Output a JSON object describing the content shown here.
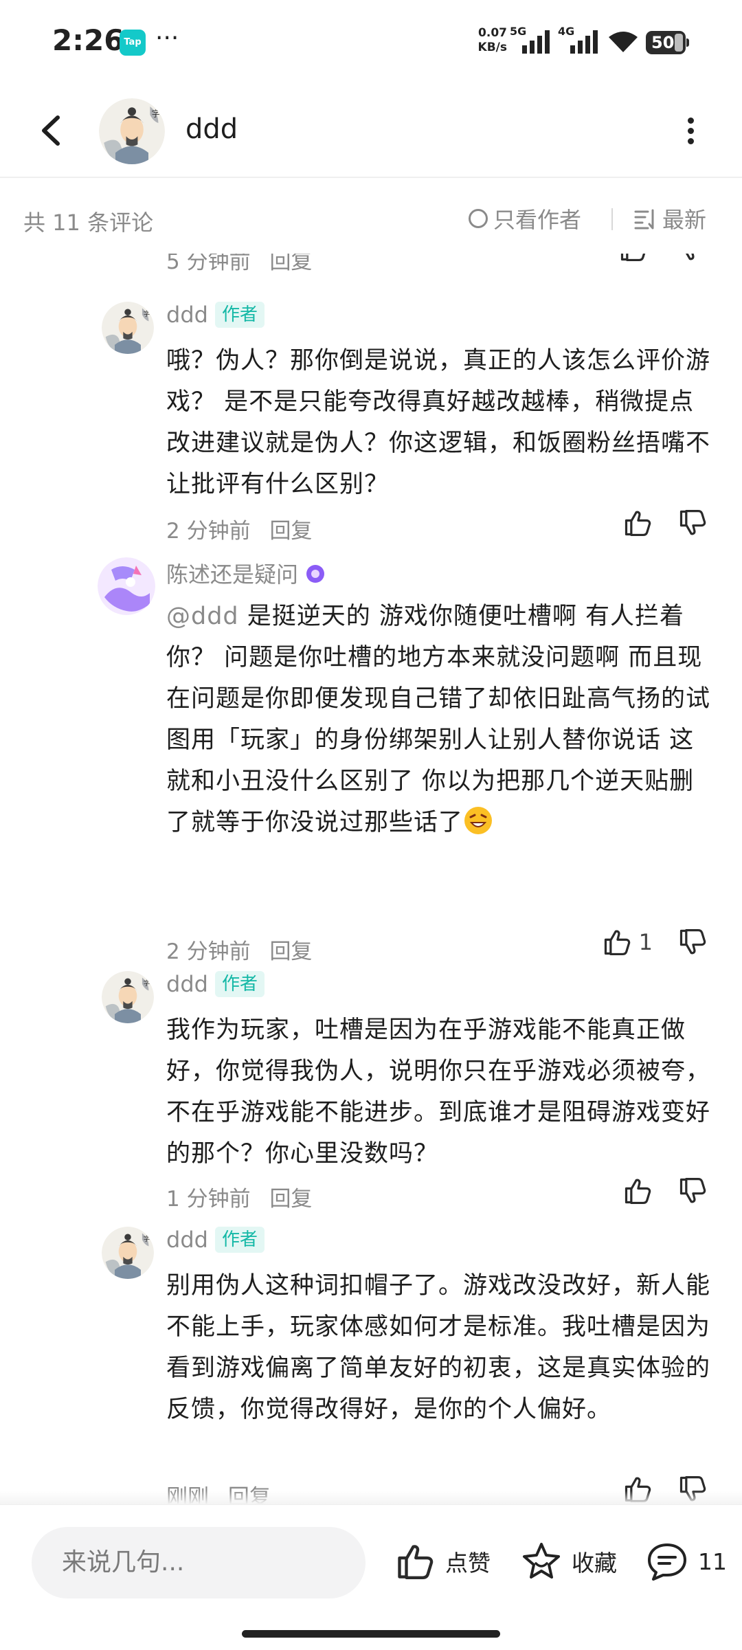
{
  "status_bar": {
    "time": "2:26",
    "app_badge": "Tap",
    "more": "···",
    "speed_value": "0.07",
    "speed_unit": "KB/s",
    "net1": "5G",
    "net2": "4G",
    "battery": "50"
  },
  "header": {
    "title": "ddd"
  },
  "filter": {
    "count_label": "共 11 条评论",
    "only_author_label": "只看作者",
    "sort_label": "最新"
  },
  "comments": [
    {
      "name": "ddd",
      "badge": "作者",
      "text": "哦？伪人？那你倒是说说，真正的人该怎么评价游戏？ 是不是只能夸改得真好越改越棒，稍微提点改进建议就是伪人？你这逻辑，和饭圈粉丝捂嘴不让批评有什么区别？",
      "time": "2 分钟前",
      "reply": "回复"
    },
    {
      "name": "陈述还是疑问",
      "mention": "@ddd",
      "text": "  是挺逆天的  游戏你随便吐槽啊  有人拦着你？    问题是你吐槽的地方本来就没问题啊  而且现在问题是你即便发现自己错了却依旧趾高气扬的试图用「玩家」的身份绑架别人让别人替你说话   这就和小丑没什么区别了   你以为把那几个逆天贴删了就等于你没说过那些话了",
      "time": "2 分钟前",
      "reply": "回复",
      "likes": "1"
    },
    {
      "name": "ddd",
      "badge": "作者",
      "text": "我作为玩家，吐槽是因为在乎游戏能不能真正做好，你觉得我伪人，说明你只在乎游戏必须被夸，不在乎游戏能不能进步。到底谁才是阻碍游戏变好的那个？你心里没数吗？",
      "time": "1 分钟前",
      "reply": "回复"
    },
    {
      "name": "ddd",
      "badge": "作者",
      "text": "别用伪人这种词扣帽子了。游戏改没改好，新人能不能上手，玩家体感如何才是标准。我吐槽是因为看到游戏偏离了简单友好的初衷，这是真实体验的反馈，你觉得改得好，是你的个人偏好。",
      "time": "刚刚",
      "reply": "回复"
    }
  ],
  "partial_top": {
    "time": "5 分钟前",
    "reply": "回复"
  },
  "bottom": {
    "input_placeholder": "来说几句...",
    "like_label": "点赞",
    "fav_label": "收藏",
    "comment_count": "11"
  },
  "colors": {
    "accent": "#14b8a6",
    "badge_bg": "#e3f7f4",
    "muted_text": "#8a8a8a",
    "input_bg": "#f3f3f4"
  },
  "icons": [
    "back-icon",
    "more-vertical-icon",
    "thumb-up-icon",
    "thumb-down-icon",
    "sort-icon",
    "star-icon",
    "comment-icon"
  ]
}
